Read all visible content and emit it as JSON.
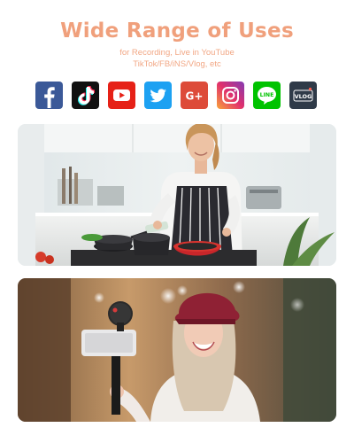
{
  "heading": "Wide Range of Uses",
  "subtitle": {
    "line1": "for Recording, Live in YouTube",
    "line2": "TikTok/FB/iNS/Vlog, etc"
  },
  "icons": [
    {
      "name": "facebook-icon",
      "glyph": "f",
      "color": "#3b5998"
    },
    {
      "name": "tiktok-icon",
      "glyph": "♪",
      "color": "#111111"
    },
    {
      "name": "youtube-icon",
      "glyph": "▶",
      "color": "#e62117"
    },
    {
      "name": "twitter-icon",
      "glyph": "bird",
      "color": "#1da1f2"
    },
    {
      "name": "google-plus-icon",
      "glyph": "G+",
      "color": "#dd4b39"
    },
    {
      "name": "instagram-icon",
      "glyph": "camera",
      "color": "#c13584"
    },
    {
      "name": "line-icon",
      "glyph": "LINE",
      "color": "#00c300"
    },
    {
      "name": "vlog-icon",
      "glyph": "VLOG",
      "color": "#2f3a48"
    }
  ],
  "colors": {
    "heading": "#f0a07c",
    "subtitle": "#f2a886"
  }
}
